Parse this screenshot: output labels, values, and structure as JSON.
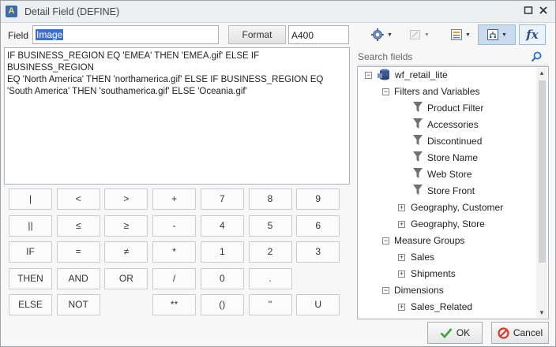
{
  "window": {
    "title": "Detail Field (DEFINE)"
  },
  "field": {
    "label": "Field",
    "value": "Image"
  },
  "format": {
    "button_label": "Format",
    "value": "A400"
  },
  "expression": "IF BUSINESS_REGION EQ 'EMEA' THEN 'EMEA.gif' ELSE IF BUSINESS_REGION\nEQ 'North America' THEN 'northamerica.gif' ELSE IF BUSINESS_REGION EQ\n'South America' THEN 'southamerica.gif' ELSE 'Oceania.gif'",
  "keypad": {
    "rows": [
      [
        "|",
        "<",
        ">",
        "+",
        "7",
        "8",
        "9"
      ],
      [
        "||",
        "≤",
        "≥",
        "-",
        "4",
        "5",
        "6"
      ],
      [
        "IF",
        "=",
        "≠",
        "*",
        "1",
        "2",
        "3"
      ],
      [
        "THEN",
        "AND",
        "OR",
        "/",
        "0",
        ".",
        ""
      ],
      [
        "ELSE",
        "NOT",
        "",
        "**",
        "()",
        "''",
        "U"
      ]
    ]
  },
  "toolbar": {
    "items": [
      "settings-icon",
      "edit-disabled-icon",
      "list-icon",
      "tree-icon",
      "function-icon"
    ],
    "function_label": "fx"
  },
  "search": {
    "placeholder": "Search fields"
  },
  "tree": {
    "root": "wf_retail_lite",
    "filters_label": "Filters and Variables",
    "filters": [
      "Product Filter",
      "Accessories",
      "Discontinued",
      "Store Name",
      "Web Store",
      "Store Front"
    ],
    "geo_customer": "Geography, Customer",
    "geo_store": "Geography, Store",
    "measure_groups": "Measure Groups",
    "sales": "Sales",
    "shipments": "Shipments",
    "dimensions": "Dimensions",
    "sales_related": "Sales_Related"
  },
  "buttons": {
    "ok": "OK",
    "cancel": "Cancel"
  },
  "colors": {
    "accent": "#3b6fd1",
    "filter_icon": "#707070",
    "ok_check": "#3ba33b",
    "cancel_icon": "#d23a2a"
  }
}
